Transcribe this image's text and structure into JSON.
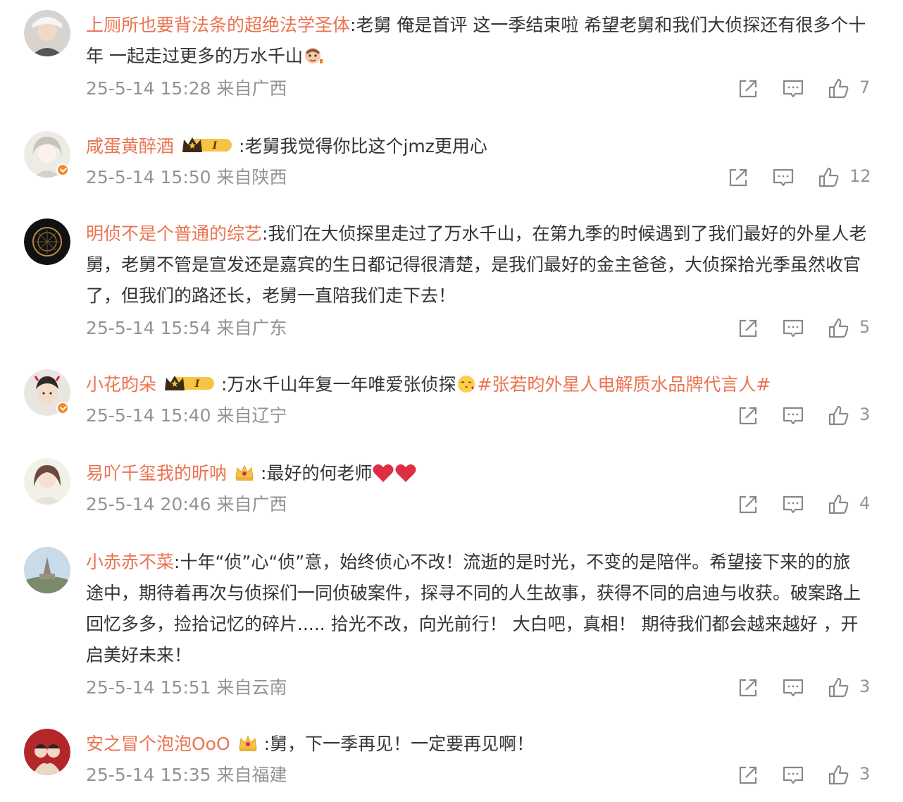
{
  "comments": [
    {
      "user": "上厕所也要背法条的超绝法学圣体",
      "text": ":老舅 俺是首评 这一季结束啦 希望老舅和我们大侦探还有很多个十年 一起走过更多的万水千山",
      "meta": "25-5-14 15:28 来自广西",
      "likes": "7"
    },
    {
      "user": "咸蛋黄醉酒",
      "text": ":老舅我觉得你比这个jmz更用心",
      "meta": "25-5-14 15:50 来自陕西",
      "likes": "12"
    },
    {
      "user": "明侦不是个普通的综艺",
      "text": ":我们在大侦探里走过了万水千山，在第九季的时候遇到了我们最好的外星人老舅，老舅不管是宣发还是嘉宾的生日都记得很清楚，是我们最好的金主爸爸，大侦探拾光季虽然收官了，但我们的路还长，老舅一直陪我们走下去！",
      "meta": "25-5-14 15:54 来自广东",
      "likes": "5"
    },
    {
      "user": "小花昀朵",
      "text": ":万水千山年复一年唯爱张侦探",
      "topic": "#张若昀外星人电解质水品牌代言人#",
      "meta": "25-5-14 15:40 来自辽宁",
      "likes": "3"
    },
    {
      "user": "易吖千玺我的昕呐",
      "text": ":最好的何老师",
      "meta": "25-5-14 20:46 来自广西",
      "likes": "4"
    },
    {
      "user": "小赤赤不菜",
      "text": ":十年“侦”心“侦”意，始终侦心不改！流逝的是时光，不变的是陪伴。希望接下来的的旅途中，期待着再次与侦探们一同侦破案件，探寻不同的人生故事，获得不同的启迪与收获。破案路上回忆多多，捡拾记忆的碎片..... 拾光不改，向光前行！  大白吧，真相！  期待我们都会越来越好 ，开启美好未来！",
      "meta": "25-5-14 15:51 来自云南",
      "likes": "3"
    },
    {
      "user": "安之冒个泡泡OoO",
      "text": ":舅，下一季再见！一定要再见啊！",
      "meta": "25-5-14 15:35 来自福建",
      "likes": "3"
    }
  ],
  "badge_level": "I",
  "icons": {
    "repost": "repost-icon",
    "comment": "comment-icon",
    "like": "like-icon",
    "vip": "vip-crown-icon",
    "verified": "verified-icon"
  },
  "colors": {
    "username": "#eb7350",
    "meta": "#939393",
    "text": "#333333",
    "verified": "#f08a2c"
  }
}
